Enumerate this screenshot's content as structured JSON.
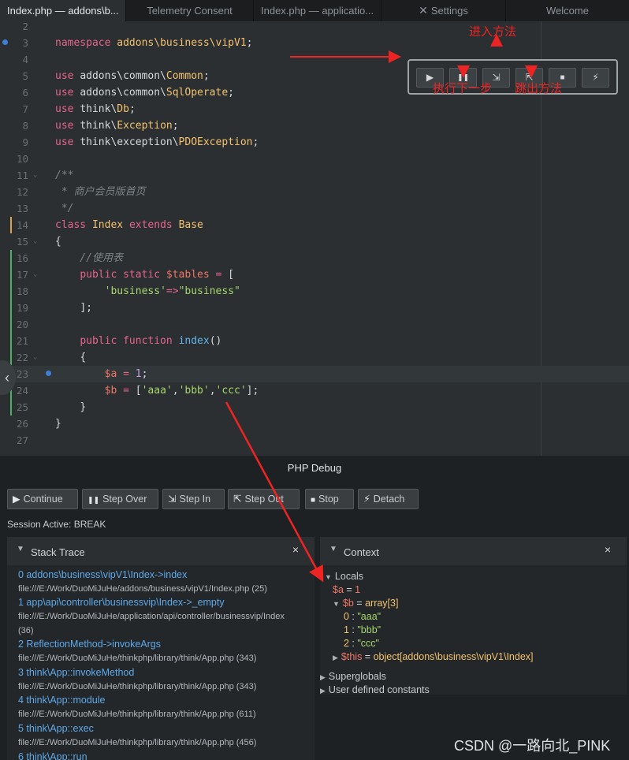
{
  "tabs": [
    {
      "label": "Index.php — addons\\b...",
      "active": true
    },
    {
      "label": "Telemetry Consent",
      "active": false
    },
    {
      "label": "Index.php — applicatio...",
      "active": false
    },
    {
      "label": "Settings",
      "active": false,
      "icon": "tools-icon"
    },
    {
      "label": "Welcome",
      "active": false
    }
  ],
  "code": {
    "current_line": 23,
    "line_numbers": [
      "2",
      "3",
      "4",
      "5",
      "6",
      "7",
      "8",
      "9",
      "10",
      "11",
      "12",
      "13",
      "14",
      "15",
      "16",
      "17",
      "18",
      "19",
      "20",
      "21",
      "22",
      "23",
      "24",
      "25",
      "26",
      "27"
    ]
  },
  "floating_toolbar": {
    "buttons": [
      {
        "name": "continue",
        "glyph": "▶"
      },
      {
        "name": "step-over",
        "glyph": "❚❚"
      },
      {
        "name": "step-in",
        "glyph": "⇲"
      },
      {
        "name": "step-out",
        "glyph": "⇱"
      },
      {
        "name": "stop",
        "glyph": "■"
      },
      {
        "name": "detach",
        "glyph": "⚡"
      }
    ]
  },
  "annotations": {
    "step_in": "进入方法",
    "step_over": "执行下一步",
    "step_out": "跳出方法"
  },
  "debug_panel": {
    "title": "PHP Debug",
    "buttons": [
      {
        "label": "Continue",
        "glyph": "▶"
      },
      {
        "label": "Step Over",
        "glyph": "❚❚"
      },
      {
        "label": "Step In",
        "glyph": "⇲"
      },
      {
        "label": "Step Out",
        "glyph": "⇱"
      },
      {
        "label": "Stop",
        "glyph": "■"
      },
      {
        "label": "Detach",
        "glyph": "⚡"
      }
    ],
    "session": "Session Active: BREAK",
    "stack_trace": {
      "title": "Stack Trace",
      "close": "×",
      "frames": [
        {
          "name": "0 addons\\business\\vipV1\\Index->index",
          "file": "file:///E:/Work/DuoMiJuHe/addons/business/vipV1/Index.php",
          "line": "(25)"
        },
        {
          "name": "1 app\\api\\controller\\businessvip\\Index->_empty",
          "file": "file:///E:/Work/DuoMiJuHe/application/api/controller/businessvip/Index",
          "line": "(36)"
        },
        {
          "name": "2 ReflectionMethod->invokeArgs",
          "file": "file:///E:/Work/DuoMiJuHe/thinkphp/library/think/App.php",
          "line": "(343)"
        },
        {
          "name": "3 think\\App::invokeMethod",
          "file": "file:///E:/Work/DuoMiJuHe/thinkphp/library/think/App.php",
          "line": "(343)"
        },
        {
          "name": "4 think\\App::module",
          "file": "file:///E:/Work/DuoMiJuHe/thinkphp/library/think/App.php",
          "line": "(611)"
        },
        {
          "name": "5 think\\App::exec",
          "file": "file:///E:/Work/DuoMiJuHe/thinkphp/library/think/App.php",
          "line": "(456)"
        },
        {
          "name": "6 think\\App::run",
          "file": "",
          "line": ""
        }
      ]
    },
    "context": {
      "title": "Context",
      "close": "×",
      "locals_label": "Locals",
      "var_a": "$a",
      "var_a_value": "1",
      "var_b": "$b",
      "var_b_type": "array[3]",
      "b_items": [
        {
          "key": "0",
          "value": "\"aaa\""
        },
        {
          "key": "1",
          "value": "\"bbb\""
        },
        {
          "key": "2",
          "value": "\"ccc\""
        }
      ],
      "var_this": "$this",
      "var_this_type": "object[addons\\business\\vipV1\\Index]",
      "superglobals": "Superglobals",
      "user_constants": "User defined constants"
    }
  },
  "watermark": "CSDN @一路向北_PINK"
}
